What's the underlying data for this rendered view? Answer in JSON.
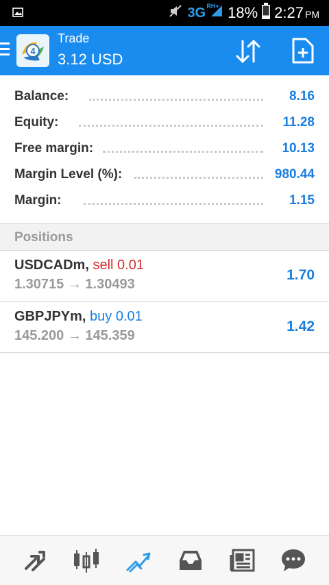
{
  "status_bar": {
    "network": "3G",
    "network_sup": "RH+",
    "battery": "18%",
    "time": "2:27",
    "ampm": "PM"
  },
  "app_bar": {
    "title": "Trade",
    "subtitle": "3.12 USD"
  },
  "summary": [
    {
      "label": "Balance:",
      "value": "8.16"
    },
    {
      "label": "Equity:",
      "value": "11.28"
    },
    {
      "label": "Free margin:",
      "value": "10.13"
    },
    {
      "label": "Margin Level (%):",
      "value": "980.44"
    },
    {
      "label": "Margin:",
      "value": "1.15"
    }
  ],
  "positions_header": "Positions",
  "positions": [
    {
      "symbol": "USDCADm,",
      "direction": "sell 0.01",
      "direction_color": "#d32f2f",
      "open": "1.30715",
      "current": "1.30493",
      "profit": "1.70"
    },
    {
      "symbol": "GBPJPYm,",
      "direction": "buy 0.01",
      "direction_color": "#1a7fe0",
      "open": "145.200",
      "current": "145.359",
      "profit": "1.42"
    }
  ],
  "arrow": "→",
  "colors": {
    "accent": "#1a8cf0",
    "value": "#1a7fe0",
    "sell": "#d32f2f"
  },
  "bottom_tabs": [
    "quotes-icon",
    "chart-icon",
    "trade-icon",
    "history-icon",
    "news-icon",
    "chat-icon"
  ],
  "active_tab": "trade-icon"
}
